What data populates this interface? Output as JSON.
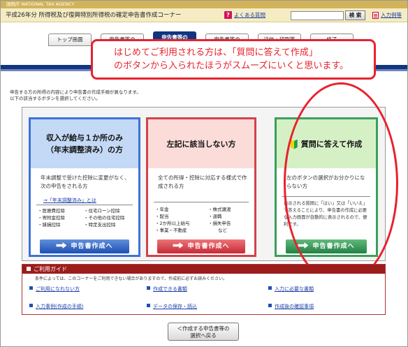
{
  "header": {
    "agency": "国税庁 NATIONAL TAX AGENCY",
    "title": "平成26年分  所得税及び復興特別所得税の確定申告書作成コーナー",
    "faq_label": "よくある質問",
    "search_button": "検 索",
    "example_label": "入力例等"
  },
  "steps": [
    {
      "label": "トップ画面"
    },
    {
      "label": "申告書等の"
    },
    {
      "label": "申告書等の"
    },
    {
      "label": "申告書等の"
    },
    {
      "label": "送信・印刷等"
    },
    {
      "label": "終了"
    }
  ],
  "callout": {
    "line1": "はじめてご利用される方は、「質問に答えて作成」",
    "line2": "のボタンから入られたほうがスムーズにいくと思います。"
  },
  "instructions": {
    "line1": "申告する方の所得の内容により申告書の作成手順が異なります。",
    "line2": "以下の該当するボタンを選択してください。"
  },
  "cards": {
    "salary": {
      "title1": "収入が給与１か所のみ",
      "title2": "（年末調整済み）の方",
      "desc": "年末調整で受けた控除に変更がなく、次の申告をされる方",
      "link": "→「年末調整済み」とは",
      "items_left": [
        "・医療費控除",
        "・寄附金控除",
        "・雑損控除"
      ],
      "items_right": [
        "・住宅ローン控除",
        "・その他の住宅控除",
        "・特定支出控除"
      ],
      "button": "申告書作成へ"
    },
    "other": {
      "title": "左記に該当しない方",
      "desc": "全ての所得・控除に対応する様式で作成される方",
      "items_left": [
        "・年金",
        "・配当",
        "・2か所以上給与",
        "・事業・不動産"
      ],
      "items_right": [
        "・株式譲渡",
        "・退職",
        "・損失申告",
        "など"
      ],
      "button": "申告書作成へ"
    },
    "qa": {
      "title": "質問に答えて作成",
      "desc": "左のボタンの選択がお分かりにならない方",
      "note": "表示される質問に「はい」又は「いいえ」で答えることにより、申告書の作成に必要な入力画面が自動的に表示されるので、便利です。",
      "button": "申告書作成へ"
    }
  },
  "guide": {
    "title": "ご利用ガイド",
    "note": "条件によっては、このコーナーをご利用できない場合がありますので、作成前に必ずお読みください。",
    "links": [
      "ご利用になれない方",
      "作成できる書類",
      "入力に必要な書類",
      "入力事例(作成の手順)",
      "データの保存・読込",
      "作成後の確認事項"
    ]
  },
  "back_button": {
    "line1": "＜作成する申告書等の",
    "line2": "選択へ戻る"
  },
  "colors": {
    "navy": "#11357e",
    "annotation_red": "#e8212e",
    "salary_blue": "#3b73d9",
    "other_red": "#d2424a",
    "qa_green": "#39a05c",
    "guide_red": "#9c1c1c"
  }
}
